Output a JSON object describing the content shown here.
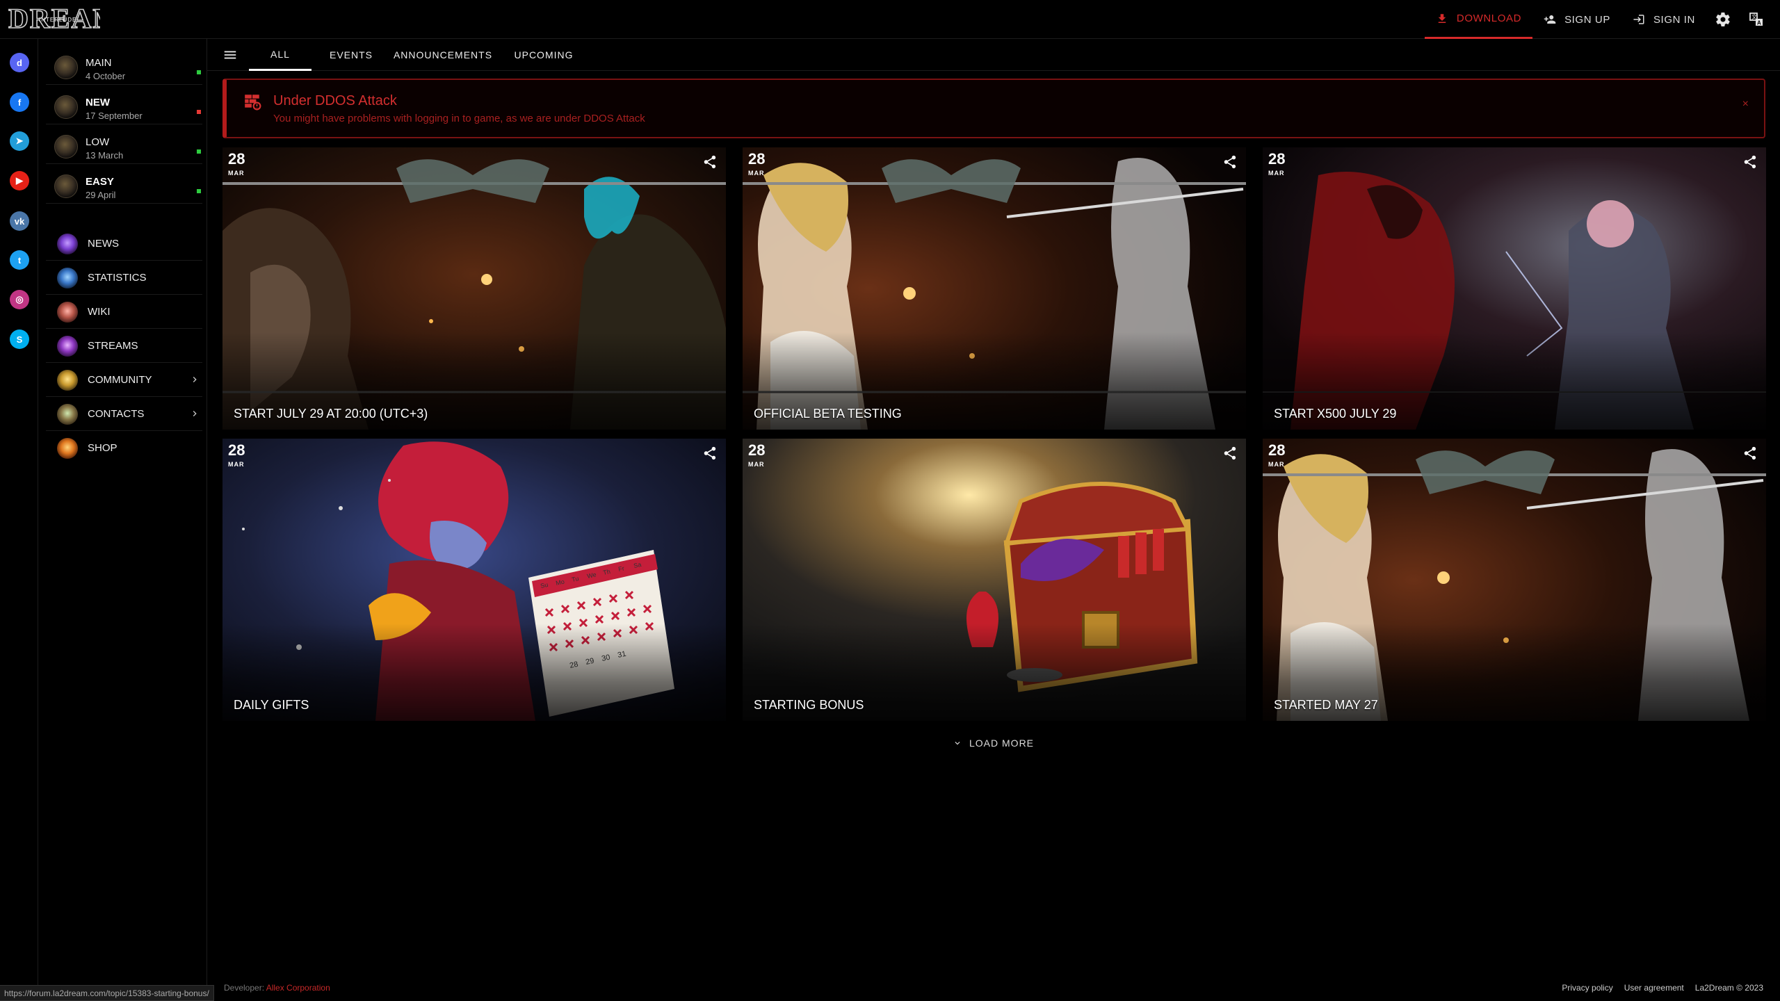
{
  "topbar": {
    "logo_text": "DREAM",
    "logo_subtext": "INTERLUDE",
    "download_label": "DOWNLOAD",
    "signup_label": "SIGN UP",
    "signin_label": "SIGN IN"
  },
  "social": [
    {
      "icon": "discord-icon",
      "color": "#5865f2",
      "glyph": "d"
    },
    {
      "icon": "facebook-icon",
      "color": "#1877f2",
      "glyph": "f"
    },
    {
      "icon": "telegram-icon",
      "color": "#229ed9",
      "glyph": "➤"
    },
    {
      "icon": "youtube-icon",
      "color": "#e62117",
      "glyph": "▶"
    },
    {
      "icon": "vk-icon",
      "color": "#4a76a8",
      "glyph": "vk"
    },
    {
      "icon": "twitter-icon",
      "color": "#1da1f2",
      "glyph": "t"
    },
    {
      "icon": "instagram-icon",
      "color": "#c13584",
      "glyph": "◎"
    },
    {
      "icon": "skype-icon",
      "color": "#00aff0",
      "glyph": "S"
    }
  ],
  "servers": [
    {
      "name": "MAIN",
      "date": "4 October",
      "status_color": "#2ecc40",
      "bold": false
    },
    {
      "name": "NEW",
      "date": "17 September",
      "status_color": "#e53935",
      "bold": true
    },
    {
      "name": "LOW",
      "date": "13 March",
      "status_color": "#2ecc40",
      "bold": false
    },
    {
      "name": "EASY",
      "date": "29 April",
      "status_color": "#2ecc40",
      "bold": true
    }
  ],
  "menu": [
    {
      "label": "NEWS",
      "icon": "news-icon",
      "has_submenu": false
    },
    {
      "label": "STATISTICS",
      "icon": "statistics-icon",
      "has_submenu": false
    },
    {
      "label": "WIKI",
      "icon": "wiki-icon",
      "has_submenu": false
    },
    {
      "label": "STREAMS",
      "icon": "streams-icon",
      "has_submenu": false
    },
    {
      "label": "COMMUNITY",
      "icon": "community-icon",
      "has_submenu": true
    },
    {
      "label": "CONTACTS",
      "icon": "contacts-icon",
      "has_submenu": true
    },
    {
      "label": "SHOP",
      "icon": "shop-icon",
      "has_submenu": false
    }
  ],
  "tabs": [
    "ALL",
    "EVENTS",
    "ANNOUNCEMENTS",
    "UPCOMING"
  ],
  "active_tab": "ALL",
  "alert": {
    "title": "Under DDOS Attack",
    "text": "You might have problems with logging in to game, as we are under DDOS Attack",
    "close": "×"
  },
  "cards": [
    {
      "day": "28",
      "month": "MAR",
      "title": "START JULY 29 AT 20:00 (UTC+3)"
    },
    {
      "day": "28",
      "month": "MAR",
      "title": "OFFICIAL BETA TESTING"
    },
    {
      "day": "28",
      "month": "MAR",
      "title": "START X500 JULY 29"
    },
    {
      "day": "28",
      "month": "MAR",
      "title": "DAILY GIFTS"
    },
    {
      "day": "28",
      "month": "MAR",
      "title": "STARTING BONUS"
    },
    {
      "day": "28",
      "month": "MAR",
      "title": "STARTED MAY 27"
    }
  ],
  "calendar_days": [
    "Su",
    "Mo",
    "Tu",
    "We",
    "Th",
    "Fr",
    "Sa"
  ],
  "calendar_dates": [
    "28",
    "29",
    "30",
    "31"
  ],
  "load_more": "LOAD MORE",
  "footer": {
    "status_url": "https://forum.la2dream.com/topic/15383-starting-bonus/",
    "developer_prefix": "Developer:",
    "developer_name": "Allex Corporation",
    "privacy": "Privacy policy",
    "agreement": "User agreement",
    "copyright": "La2Dream © 2023"
  },
  "colors": {
    "accent": "#d62a2a",
    "background": "#000000",
    "online": "#2ecc40",
    "offline": "#e53935"
  }
}
